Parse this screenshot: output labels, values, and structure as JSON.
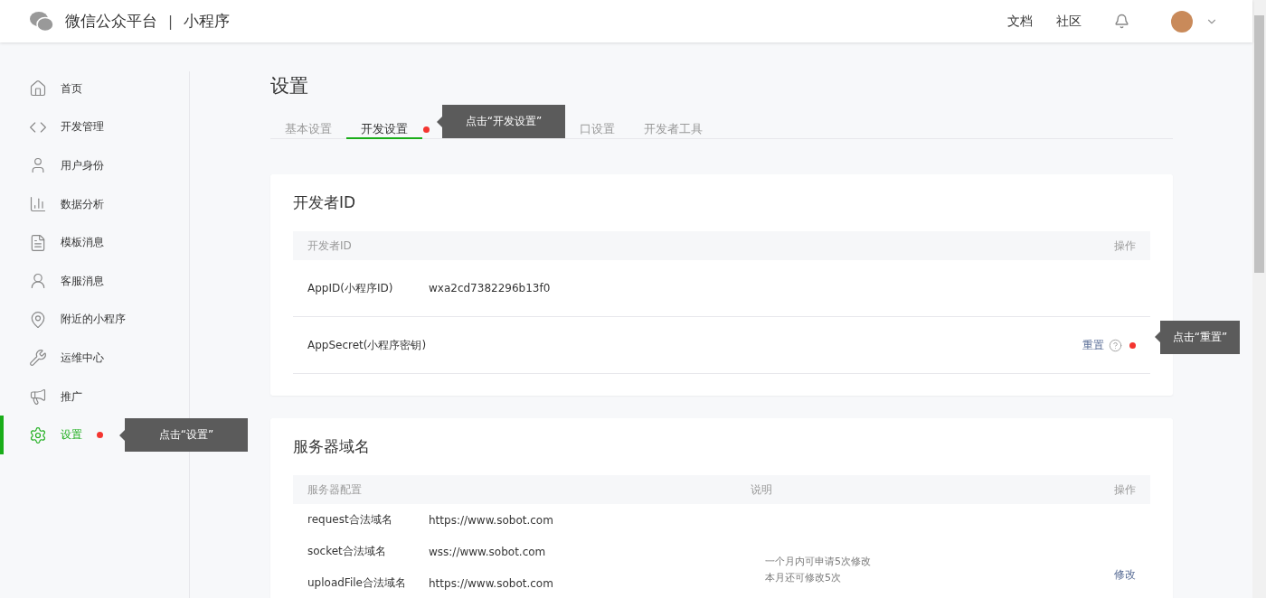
{
  "header": {
    "brand": "微信公众平台",
    "separator": "|",
    "product": "小程序",
    "links": [
      "文档",
      "社区"
    ]
  },
  "sidebar": {
    "items": [
      {
        "label": "首页",
        "selected": false
      },
      {
        "label": "开发管理",
        "selected": false
      },
      {
        "label": "用户身份",
        "selected": false
      },
      {
        "label": "数据分析",
        "selected": false
      },
      {
        "label": "模板消息",
        "selected": false
      },
      {
        "label": "客服消息",
        "selected": false
      },
      {
        "label": "附近的小程序",
        "selected": false
      },
      {
        "label": "运维中心",
        "selected": false
      },
      {
        "label": "推广",
        "selected": false
      },
      {
        "label": "设置",
        "selected": true,
        "tooltip": "点击“设置”"
      }
    ]
  },
  "page": {
    "title": "设置",
    "tabs": [
      {
        "label": "基本设置",
        "selected": false
      },
      {
        "label": "开发设置",
        "selected": true,
        "tooltip": "点击“开发设置”"
      },
      {
        "label": "口设置",
        "selected": false
      },
      {
        "label": "开发者工具",
        "selected": false
      }
    ]
  },
  "developer_id": {
    "title": "开发者ID",
    "columns": [
      "开发者ID",
      "操作"
    ],
    "rows": [
      {
        "label": "AppID(小程序ID)",
        "value": "wxa2cd7382296b13f0"
      },
      {
        "label": "AppSecret(小程序密钥)",
        "action": "重置",
        "tooltip": "点击“重置”"
      }
    ]
  },
  "server_domains": {
    "title": "服务器域名",
    "columns": [
      "服务器配置",
      "说明",
      "操作"
    ],
    "rows": [
      {
        "label": "request合法域名",
        "value": "https://www.sobot.com"
      },
      {
        "label": "socket合法域名",
        "value": "wss://www.sobot.com"
      },
      {
        "label": "uploadFile合法域名",
        "value": "https://www.sobot.com"
      }
    ],
    "note": [
      "一个月内可申请5次修改",
      "本月还可修改5次"
    ],
    "action": "修改"
  }
}
